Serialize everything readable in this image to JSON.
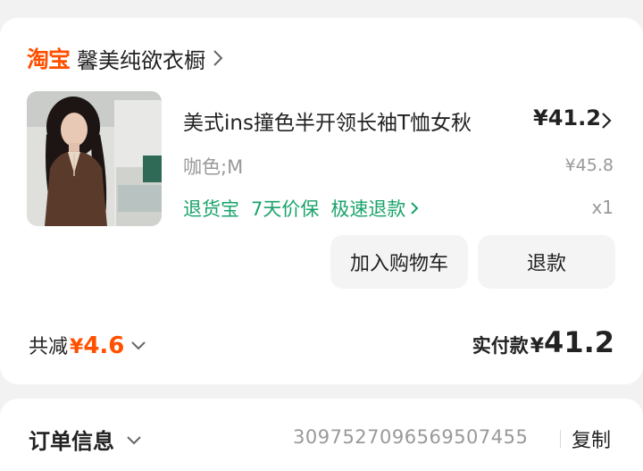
{
  "shop": {
    "logo": "淘宝",
    "name": "馨美纯欲衣橱"
  },
  "product": {
    "title": "美式ins撞色半开领长袖T恤女秋",
    "price": "¥41.2",
    "spec": "咖色;M",
    "original_price": "¥45.8",
    "quantity": "x1",
    "services": [
      "退货宝",
      "7天价保",
      "极速退款"
    ]
  },
  "actions": {
    "add_to_cart": "加入购物车",
    "refund": "退款"
  },
  "summary": {
    "discount_label": "共减",
    "discount_currency": "¥",
    "discount_value": "4.6",
    "paid_label": "实付款",
    "paid_currency": "¥",
    "paid_value": "41.2"
  },
  "order_info": {
    "title": "订单信息",
    "order_number": "3097527096569507455",
    "copy_label": "复制"
  },
  "colors": {
    "brand_orange": "#ff5000",
    "service_green": "#1aa36b",
    "muted_gray": "#999999"
  }
}
